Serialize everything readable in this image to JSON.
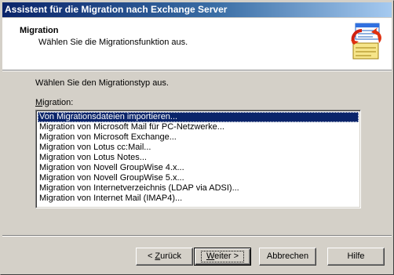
{
  "window": {
    "title": "Assistent für die Migration nach Exchange Server"
  },
  "header": {
    "title": "Migration",
    "subtitle": "Wählen Sie die Migrationsfunktion aus.",
    "icon": "migration-wizard-icon"
  },
  "main": {
    "prompt": "Wählen Sie den Migrationstyp aus.",
    "list_label_accel": "M",
    "list_label_rest": "igration:",
    "items": [
      "Von Migrationsdateien importieren...",
      "Migration von Microsoft Mail für PC-Netzwerke...",
      "Migration von Microsoft Exchange...",
      "Migration von Lotus cc:Mail...",
      "Migration von Lotus Notes...",
      "Migration von Novell GroupWise 4.x...",
      "Migration von Novell GroupWise 5.x...",
      "Migration von Internetverzeichnis (LDAP via ADSI)...",
      "Migration von Internet Mail (IMAP4)..."
    ],
    "selected_index": 0
  },
  "buttons": {
    "back_prefix": "< ",
    "back_accel": "Z",
    "back_rest": "urück",
    "next_accel": "W",
    "next_rest": "eiter >",
    "cancel": "Abbrechen",
    "help": "Hilfe"
  },
  "colors": {
    "title_gradient_start": "#0a246a",
    "title_gradient_end": "#a6caf0",
    "selection": "#0a246a",
    "face": "#d4d0c8"
  }
}
